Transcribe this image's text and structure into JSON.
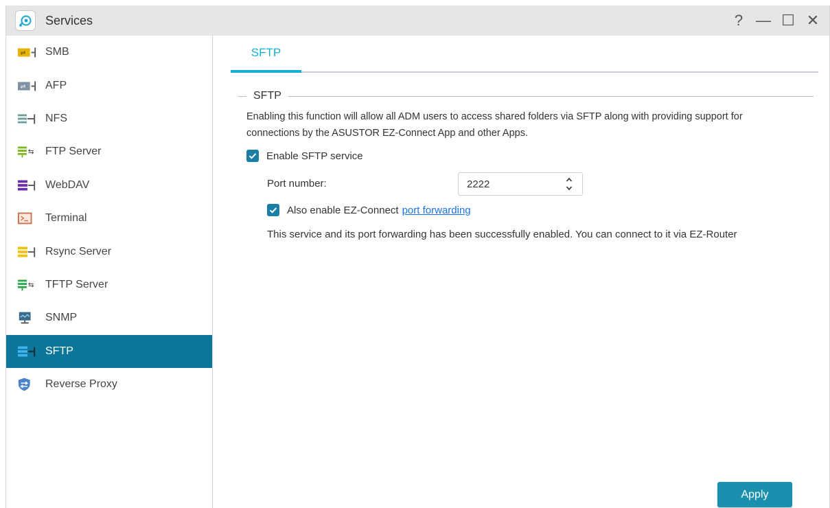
{
  "window": {
    "title": "Services",
    "controls": [
      "?",
      "—",
      "☐",
      "✕"
    ]
  },
  "sidebar": {
    "items": [
      {
        "label": "SMB",
        "icon": "smb-icon",
        "color": "#e8b40a"
      },
      {
        "label": "AFP",
        "icon": "afp-icon",
        "color": "#7f92a3"
      },
      {
        "label": "NFS",
        "icon": "nfs-icon",
        "color": "#6a9e9a"
      },
      {
        "label": "FTP Server",
        "icon": "ftp-server-icon",
        "color": "#7fb51f"
      },
      {
        "label": "WebDAV",
        "icon": "webdav-icon",
        "color": "#6b2fa5"
      },
      {
        "label": "Terminal",
        "icon": "terminal-icon",
        "color": "#c8704a"
      },
      {
        "label": "Rsync Server",
        "icon": "rsync-server-icon",
        "color": "#f2c10f"
      },
      {
        "label": "TFTP Server",
        "icon": "tftp-server-icon",
        "color": "#2aa84a"
      },
      {
        "label": "SNMP",
        "icon": "snmp-icon",
        "color": "#3a6a8c"
      },
      {
        "label": "SFTP",
        "icon": "sftp-icon",
        "color": "#2c9be0",
        "active": true
      },
      {
        "label": "Reverse Proxy",
        "icon": "reverse-proxy-icon",
        "color": "#4a83c9"
      }
    ],
    "active_color": "#0a7699"
  },
  "main": {
    "tab": "SFTP",
    "accent_color": "#13b0cf",
    "section_title": "SFTP",
    "description": "Enabling this function will allow all ADM users to access shared folders via SFTP along with providing support for connections by the ASUSTOR EZ-Connect App and other Apps.",
    "enable_sftp": {
      "label": "Enable SFTP service",
      "checked": true
    },
    "port": {
      "label": "Port number:",
      "value": "2222"
    },
    "ez_connect": {
      "label": "Also enable EZ-Connect",
      "link": "port forwarding",
      "checked": true
    },
    "status": "This service and its port forwarding has been successfully enabled. You can connect to it via EZ-Router",
    "apply_label": "Apply",
    "apply_color": "#1a8fae"
  }
}
